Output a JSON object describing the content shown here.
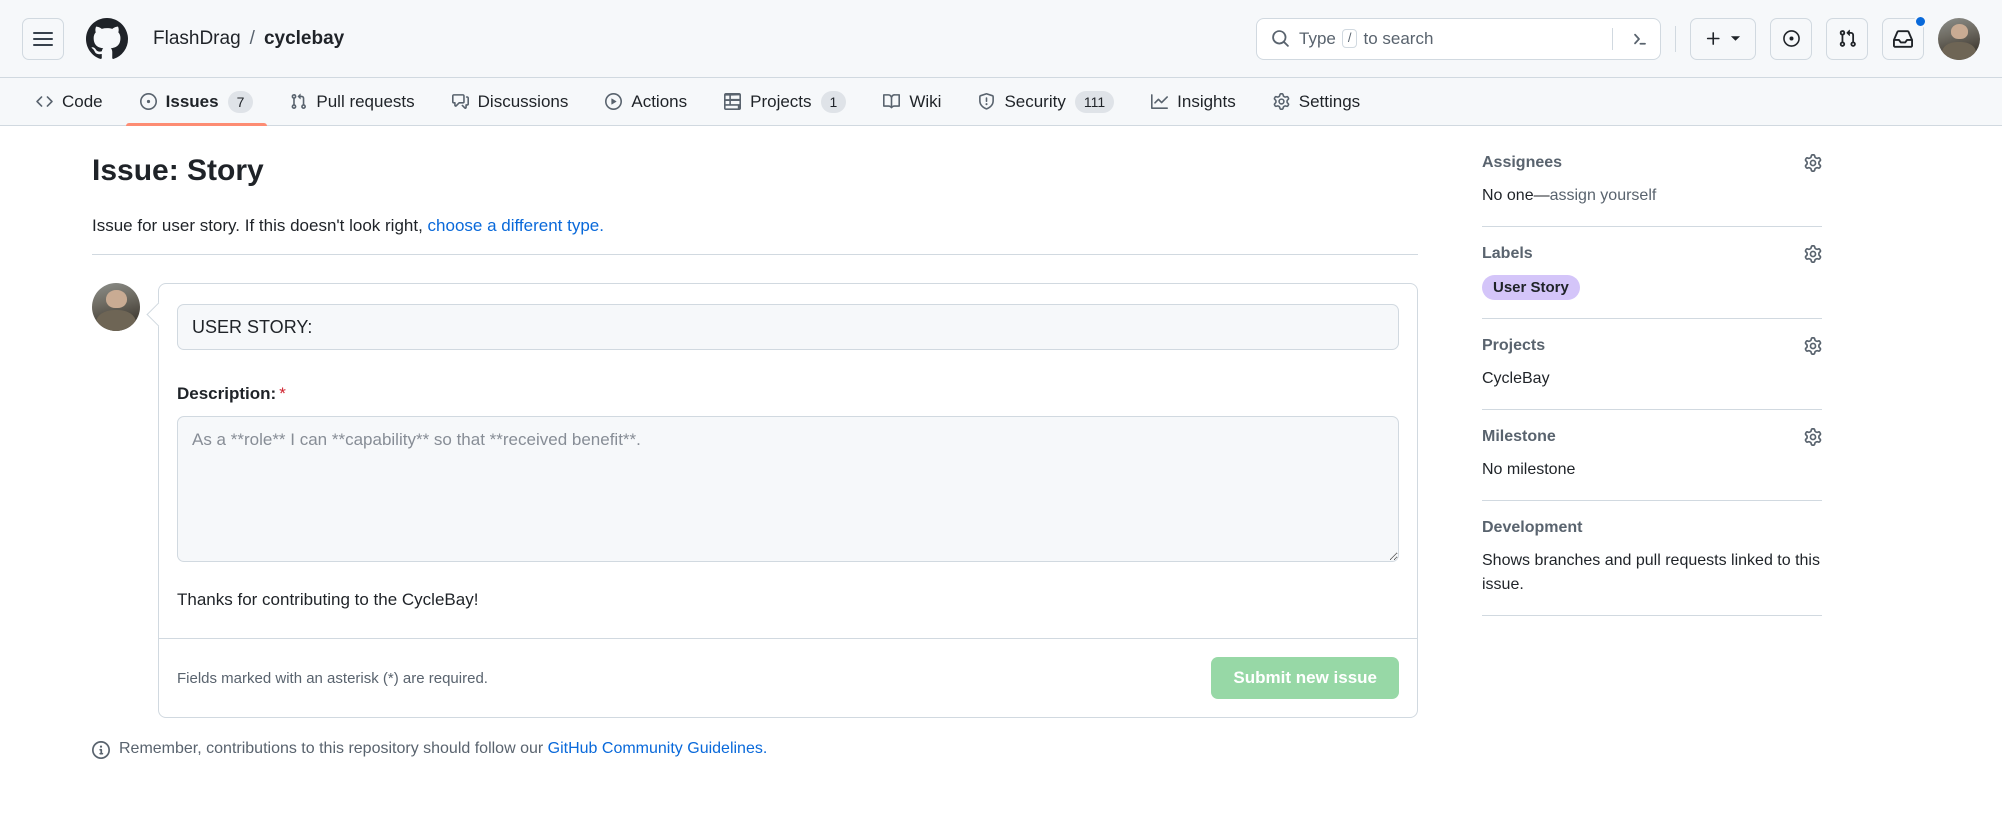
{
  "header": {
    "hamburger_label": "Open menu",
    "logo_name": "github-logo",
    "breadcrumb": {
      "owner": "FlashDrag",
      "separator": "/",
      "repo": "cyclebay"
    },
    "search": {
      "placeholder_prefix": "Type",
      "key_hint": "/",
      "placeholder_suffix": "to search"
    },
    "actions": {
      "terminal_label": "Open Copilot CLI",
      "create_new_label": "Create new...",
      "copilot_label": "Copilot",
      "pull_requests_label": "Pull requests",
      "notifications_label": "Notifications",
      "avatar_label": "Open user account menu"
    }
  },
  "nav": {
    "items": [
      {
        "label": "Code",
        "icon": "code-icon",
        "count": "",
        "active": false
      },
      {
        "label": "Issues",
        "icon": "issue-opened-icon",
        "count": "7",
        "active": true
      },
      {
        "label": "Pull requests",
        "icon": "git-pull-request-icon",
        "count": "",
        "active": false
      },
      {
        "label": "Discussions",
        "icon": "comment-discussion-icon",
        "count": "",
        "active": false
      },
      {
        "label": "Actions",
        "icon": "play-icon",
        "count": "",
        "active": false
      },
      {
        "label": "Projects",
        "icon": "table-icon",
        "count": "1",
        "active": false
      },
      {
        "label": "Wiki",
        "icon": "book-icon",
        "count": "",
        "active": false
      },
      {
        "label": "Security",
        "icon": "shield-icon",
        "count": "111",
        "active": false
      },
      {
        "label": "Insights",
        "icon": "graph-icon",
        "count": "",
        "active": false
      },
      {
        "label": "Settings",
        "icon": "gear-icon",
        "count": "",
        "active": false
      }
    ]
  },
  "main": {
    "page_title": "Issue: Story",
    "subtitle_text": "Issue for user story. If this doesn't look right,",
    "subtitle_link": "choose a different type.",
    "form": {
      "title_value": "USER STORY:",
      "title_placeholder": "Title",
      "description_label": "Description:",
      "description_required_mark": "*",
      "description_value": "",
      "description_placeholder": "As a **role** I can **capability** so that **received benefit**.",
      "thanks_text": "Thanks for contributing to the CycleBay!",
      "required_note": "Fields marked with an asterisk (*) are required.",
      "submit_label": "Submit new issue"
    },
    "footer_note_text": "Remember, contributions to this repository should follow our",
    "footer_note_link": "GitHub Community Guidelines.",
    "footer_note_icon": "info-icon"
  },
  "sidebar": {
    "sections": [
      {
        "title": "Assignees",
        "gear_icon": "gear-icon",
        "body_text": "No one—",
        "body_link": "assign yourself",
        "label": ""
      },
      {
        "title": "Labels",
        "gear_icon": "gear-icon",
        "body_text": "",
        "body_link": "",
        "label": "User Story"
      },
      {
        "title": "Projects",
        "gear_icon": "gear-icon",
        "body_text": "CycleBay",
        "body_link": "",
        "label": ""
      },
      {
        "title": "Milestone",
        "gear_icon": "gear-icon",
        "body_text": "No milestone",
        "body_link": "",
        "label": ""
      },
      {
        "title": "Development",
        "gear_icon": "",
        "body_text": "Shows branches and pull requests linked to this issue.",
        "body_link": "",
        "label": ""
      }
    ]
  },
  "colors": {
    "accent_link": "#0969da",
    "active_tab_underline": "#fd8c73",
    "label_user_story_bg": "#d4c5f9",
    "submit_button_bg": "#97d8a6",
    "required_star": "#cf222e",
    "notification_dot": "#0969da",
    "header_bg": "#f6f8fa",
    "border": "#d1d9e0"
  }
}
